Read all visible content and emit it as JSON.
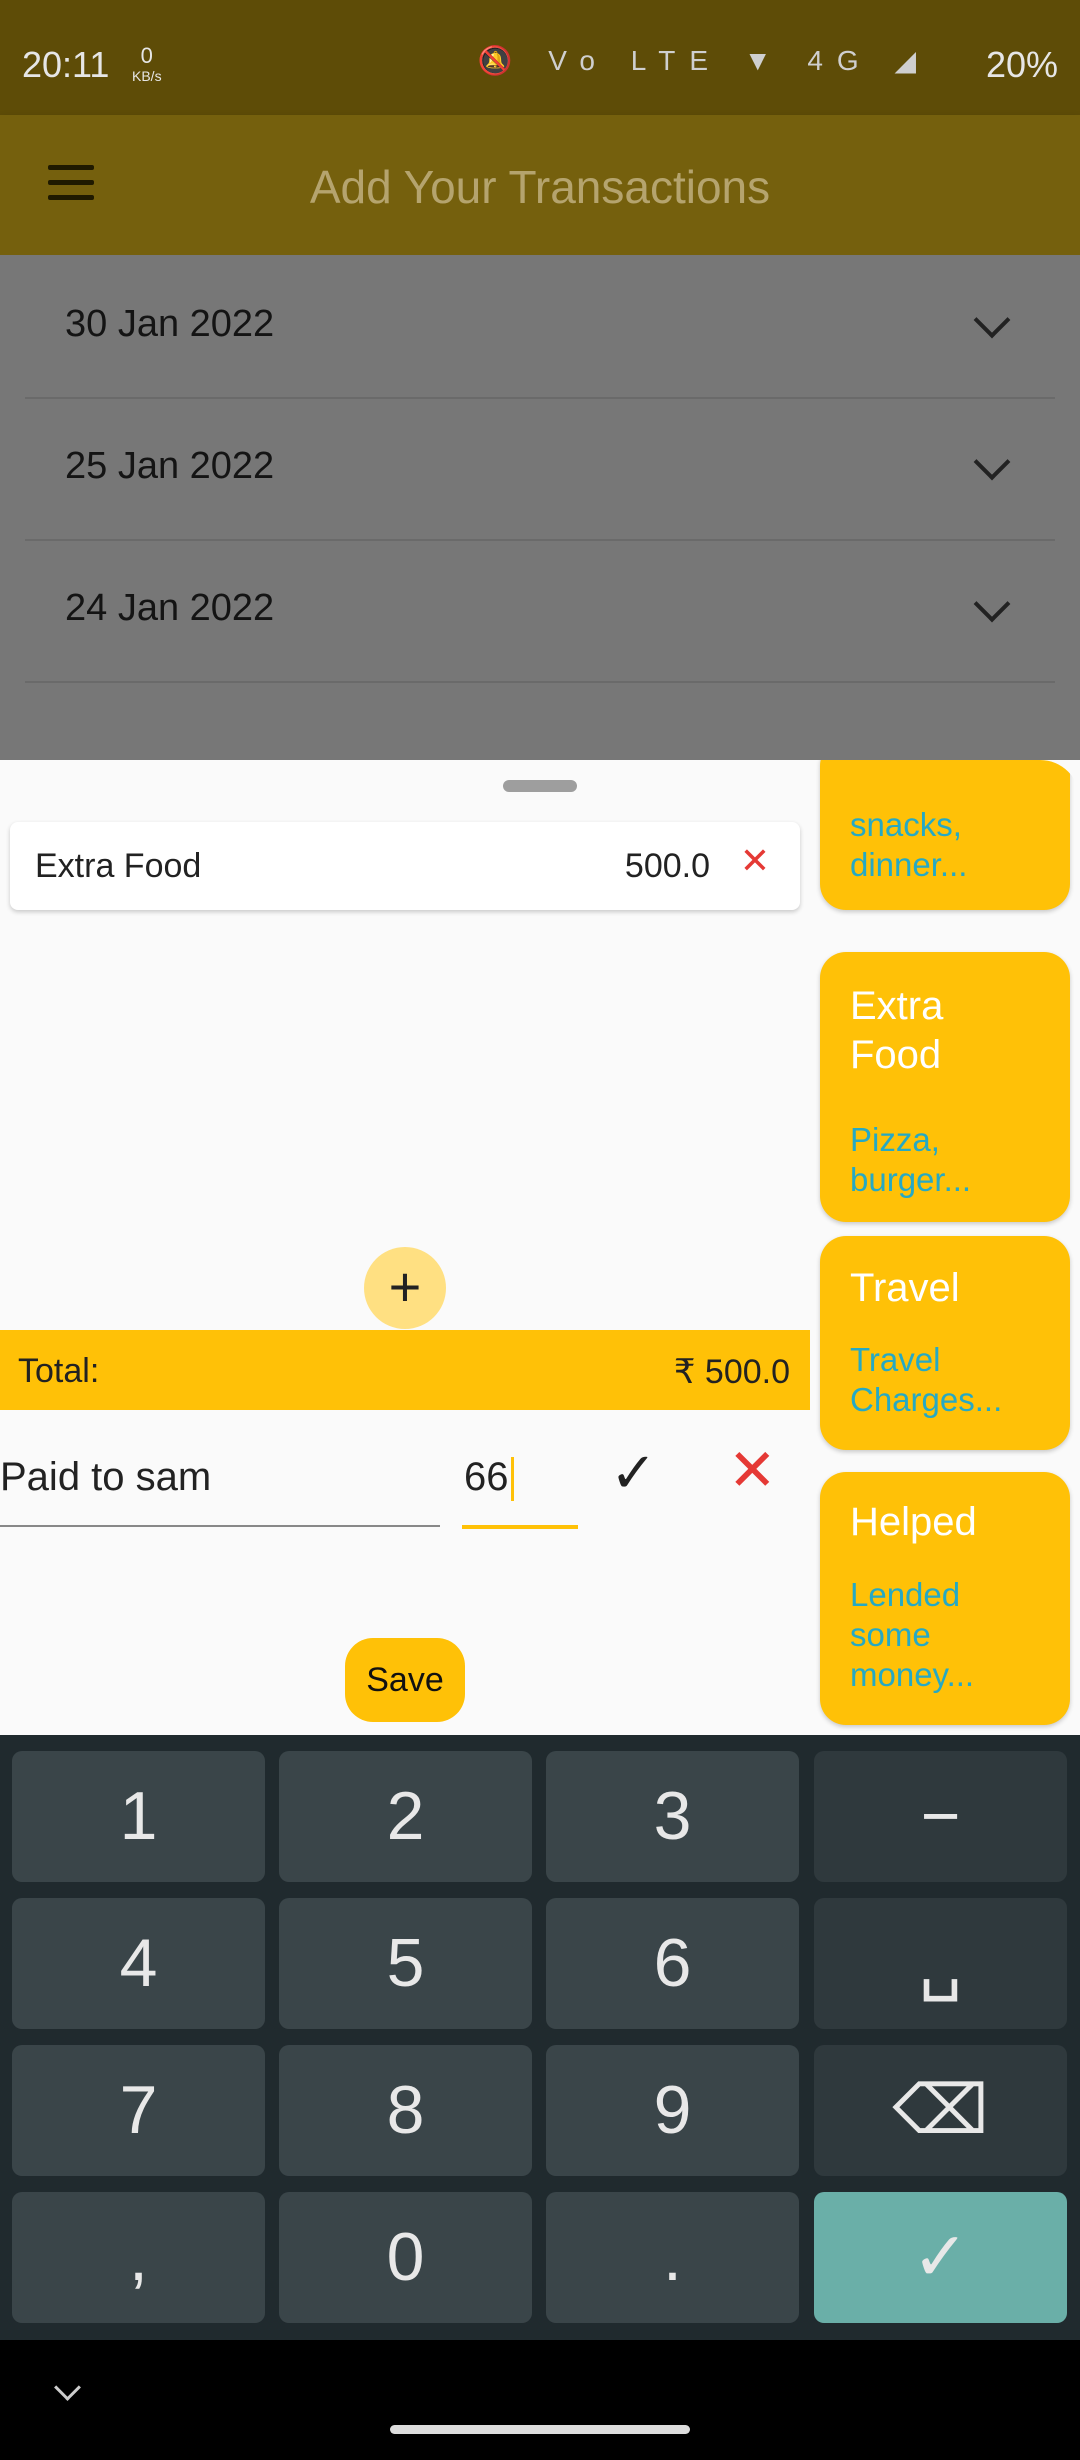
{
  "status": {
    "time": "20:11",
    "net_speed": "0",
    "net_unit": "KB/s",
    "icons": "🔕 Vo LTE ▼ 4G ◢",
    "battery": "20%"
  },
  "appbar": {
    "title": "Add Your Transactions"
  },
  "dates": [
    "30 Jan 2022",
    "25 Jan 2022",
    "24 Jan 2022"
  ],
  "sheet": {
    "item": {
      "name": "Extra Food",
      "amount": "500.0",
      "remove": "✕"
    },
    "add": "+",
    "total_label": "Total:",
    "total_value": "₹ 500.0",
    "desc_value": "Paid to sam",
    "amount_value": "66",
    "confirm": "✓",
    "cancel": "✕",
    "save": "Save"
  },
  "categories": [
    {
      "title": "",
      "subtitle": "snacks, dinner..."
    },
    {
      "title": "Extra Food",
      "subtitle": "Pizza, burger..."
    },
    {
      "title": "Travel",
      "subtitle": "Travel Charges..."
    },
    {
      "title": "Helped",
      "subtitle": "Lended some money..."
    }
  ],
  "keys": [
    "1",
    "2",
    "3",
    "−",
    "4",
    "5",
    "6",
    "␣",
    "7",
    "8",
    "9",
    "⌫",
    ",",
    "0",
    ".",
    "✓"
  ]
}
